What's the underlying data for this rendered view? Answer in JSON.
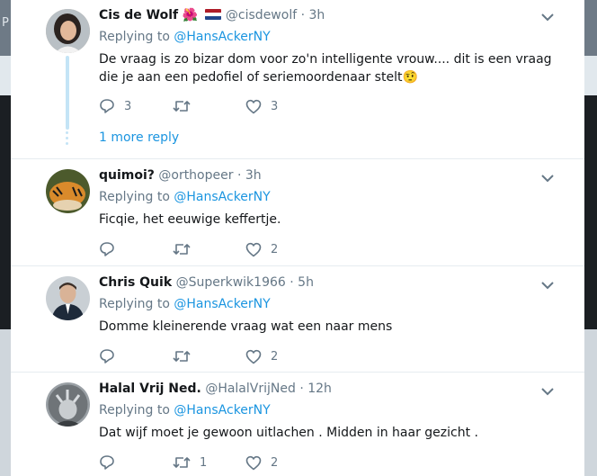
{
  "background": {
    "glyph": "P"
  },
  "common": {
    "replying_to": "Replying to",
    "dot": "·"
  },
  "tweets": [
    {
      "name": "Cis de Wolf",
      "emoji": "🌺",
      "handle": "@cisdewolf",
      "time": "3h",
      "reply_to": "@HansAckerNY",
      "text": "De vraag is zo bizar dom voor zo'n intelligente vrouw.... dit is een vraag die je aan een pedofiel of seriemoordenaar stelt🤨",
      "replies": "3",
      "retweets": "",
      "likes": "3",
      "more_reply": "1 more reply"
    },
    {
      "name": "quimoi?",
      "handle": "@orthopeer",
      "time": "3h",
      "reply_to": "@HansAckerNY",
      "text": "Ficqie, het eeuwige keffertje.",
      "replies": "",
      "retweets": "",
      "likes": "2"
    },
    {
      "name": "Chris Quik",
      "handle": "@Superkwik1966",
      "time": "5h",
      "reply_to": "@HansAckerNY",
      "text": "Domme kleinerende vraag wat een naar mens",
      "replies": "",
      "retweets": "",
      "likes": "2"
    },
    {
      "name": "Halal Vrij Ned.",
      "handle": "@HalalVrijNed",
      "time": "12h",
      "reply_to": "@HansAckerNY",
      "text": "Dat wijf moet je gewoon uitlachen . Midden in haar  gezicht .",
      "replies": "",
      "retweets": "1",
      "likes": "2"
    }
  ],
  "colors": {
    "link": "#1b95e0",
    "secondary_text": "#657786",
    "primary_text": "#14171a",
    "thread_line": "#c4e4f6",
    "flag": [
      "#ae1c28",
      "#ffffff",
      "#21468b"
    ]
  },
  "icons": {
    "reply": "reply-icon",
    "retweet": "retweet-icon",
    "like": "heart-icon",
    "caret": "chevron-down-icon",
    "flag": "netherlands-flag-icon"
  }
}
